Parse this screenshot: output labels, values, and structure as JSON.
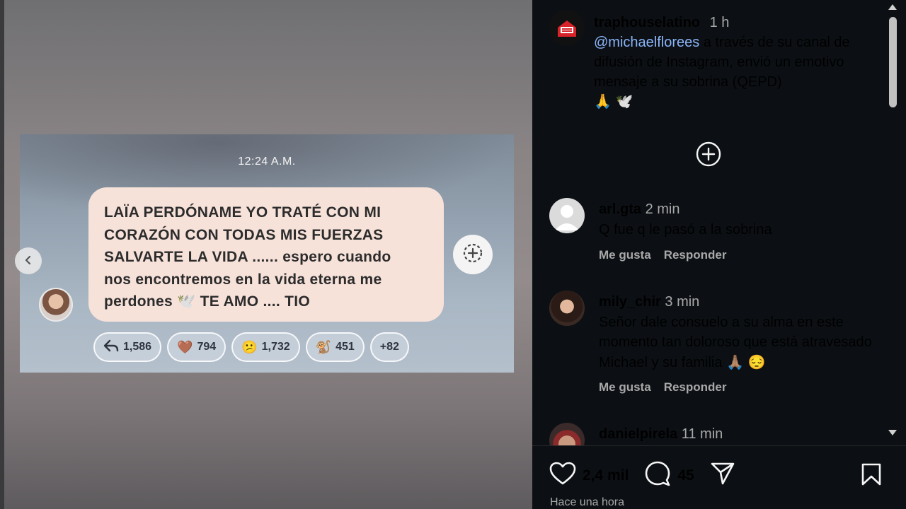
{
  "story": {
    "time": "12:24 A.M.",
    "message_line1": "LAÏA PERDÓNAME YO TRATÉ CON MI",
    "message_line2": "CORAZÓN CON TODAS MIS FUERZAS",
    "message_line3": "SALVARTE LA VIDA ...... espero cuando",
    "message_line4": "nos encontremos en la vida eterna me",
    "message_line5_a": "perdones",
    "message_line5_b": "TE AMO .... TIO",
    "reactions": [
      {
        "icon": "reply-arrow-icon",
        "count": "1,586"
      },
      {
        "icon": "brown-heart-icon",
        "count": "794"
      },
      {
        "icon": "sad-face-icon",
        "count": "1,732"
      },
      {
        "icon": "monkeys-icon",
        "count": "451"
      },
      {
        "icon": "",
        "count": "+82"
      }
    ]
  },
  "post": {
    "username": "traphouselatino",
    "time": "1 h",
    "mention": "@michaelflorees",
    "caption": " a través de su canal de difusión de Instagram, envió un emotivo mensaje a su sobrina (QEPD)",
    "caption_emojis": "🙏 🕊️"
  },
  "comments": [
    {
      "user": "arl.gta",
      "time": "2 min",
      "text": "Q fue q le pasó a la sobrina",
      "like": "Me gusta",
      "reply": "Responder"
    },
    {
      "user": "mily_chir",
      "time": "3 min",
      "text": "Señor dale consuelo a su alma en este momento tan doloroso que está atravesado Michael y su familia 🙏🏽 😔",
      "like": "Me gusta",
      "reply": "Responder"
    },
    {
      "user": "danielpirela",
      "time": "11 min"
    }
  ],
  "footer": {
    "likes": "2,4 mil",
    "comments": "45",
    "posted": "Hace una hora"
  },
  "colors": {
    "panel_bg": "#0c1014",
    "mention": "#8ab4f8",
    "bubble": "#f7e2da"
  }
}
